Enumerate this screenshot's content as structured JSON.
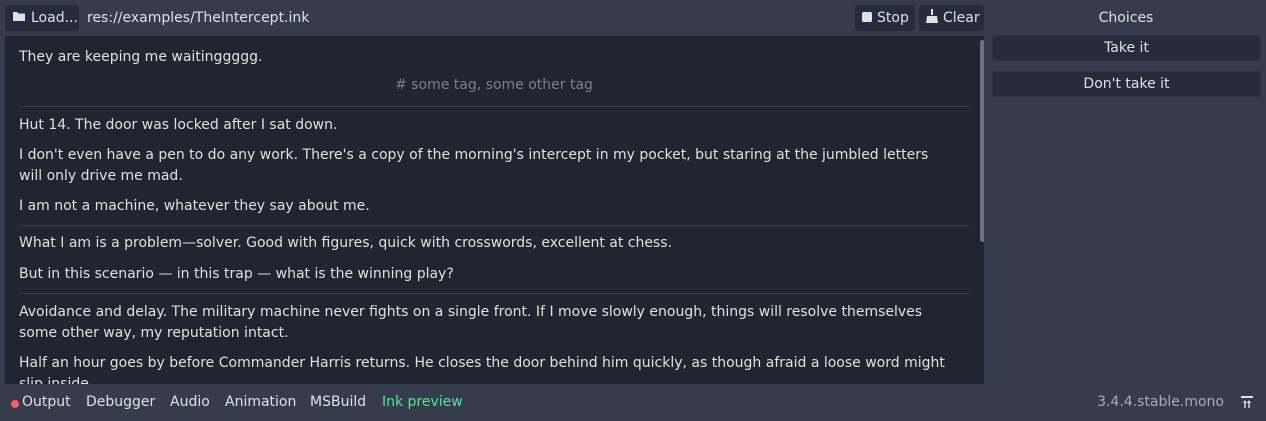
{
  "toolbar": {
    "load_label": "Load...",
    "file_path": "res://examples/TheIntercept.ink",
    "stop_label": "Stop",
    "clear_label": "Clear"
  },
  "story": {
    "blocks": [
      {
        "paragraphs": [
          "They are keeping me waitinggggg."
        ],
        "tags": "# some tag, some other tag"
      },
      {
        "paragraphs": [
          "Hut 14. The door was locked after I sat down.",
          "I don't even have a pen to do any work. There's a copy of the morning's intercept in my pocket, but staring at the jumbled letters will only drive me mad.",
          "I am not a machine, whatever they say about me."
        ]
      },
      {
        "paragraphs": [
          "What I am is a problem—solver. Good with figures, quick with crosswords, excellent at chess.",
          "But in this scenario — in this trap — what is the winning play?"
        ]
      },
      {
        "paragraphs": [
          "Avoidance and delay. The military machine never fights on a single front. If I move slowly enough, things will resolve themselves some other way, my reputation intact.",
          "Half an hour goes by before Commander Harris returns. He closes the door behind him quickly, as though afraid a loose word might slip inside."
        ]
      }
    ]
  },
  "choices": {
    "title": "Choices",
    "items": [
      "Take it",
      "Don't take it"
    ]
  },
  "bottom_panel": {
    "tabs": [
      "Output",
      "Debugger",
      "Audio",
      "Animation",
      "MSBuild",
      "Ink preview"
    ],
    "active_tab": "Ink preview",
    "version": "3.4.4.stable.mono"
  },
  "colors": {
    "accent": "#4fe3a2",
    "error_dot": "#ff5d5d"
  }
}
